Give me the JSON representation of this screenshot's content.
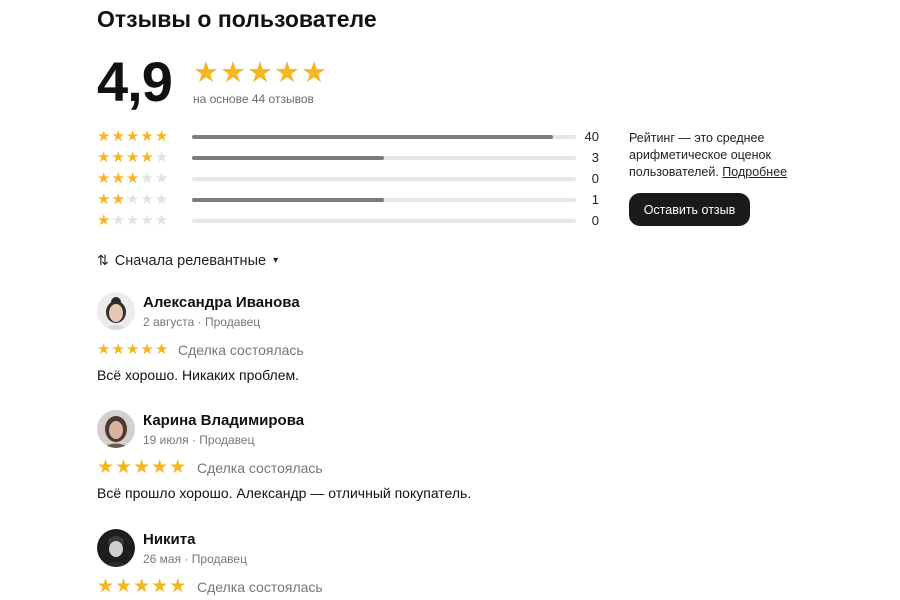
{
  "title": "Отзывы о пользователе",
  "summary": {
    "score": "4,9",
    "stars": 5,
    "based_on": "на основе 44 отзывов"
  },
  "breakdown": [
    {
      "stars": 5,
      "count": "40",
      "fill": 0.94
    },
    {
      "stars": 4,
      "count": "3",
      "fill": 0.5
    },
    {
      "stars": 3,
      "count": "0",
      "fill": 0
    },
    {
      "stars": 2,
      "count": "1",
      "fill": 0.5
    },
    {
      "stars": 1,
      "count": "0",
      "fill": 0
    }
  ],
  "info": {
    "text": "Рейтинг — это среднее арифметическое оценок пользователей.",
    "link": "Подробнее",
    "button": "Оставить отзыв"
  },
  "sort": {
    "label": "Сначала релевантные"
  },
  "reviews": [
    {
      "name": "Александра Иванова",
      "meta": "2 августа · Продавец",
      "stars": 5,
      "deal": "Сделка состоялась",
      "text": "Всё хорошо. Никаких проблем."
    },
    {
      "name": "Карина Владимирова",
      "meta": "19 июля · Продавец",
      "stars": 5,
      "deal": "Сделка состоялась",
      "text": "Всё прошло хорошо. Александр — отличный покупатель."
    },
    {
      "name": "Никита",
      "meta": "26 мая · Продавец",
      "stars": 5,
      "deal": "Сделка состоялась",
      "text": ""
    }
  ],
  "colors": {
    "star": "#f5b621",
    "star_empty": "#e2e2e2",
    "bar_fill": "#7c7c7c",
    "bar_track": "#e6e6e6",
    "button_bg": "#1a1a1a"
  }
}
